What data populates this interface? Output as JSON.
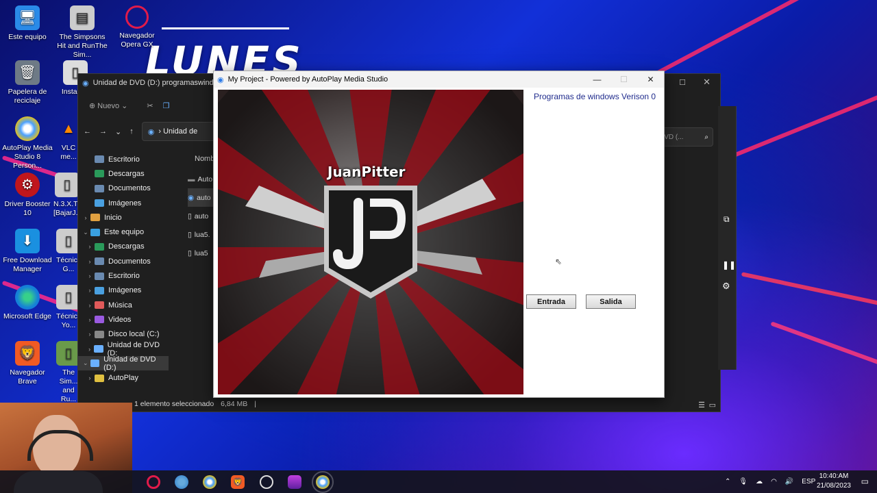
{
  "desktop": {
    "title_text": "LUNES",
    "icons": [
      {
        "label": "Este equipo"
      },
      {
        "label": "The Simpsons Hit and RunThe Sim..."
      },
      {
        "label": "Navegador Opera GX"
      },
      {
        "label": "Papelera de reciclaje"
      },
      {
        "label": "Instagr..."
      },
      {
        "label": "AutoPlay Media Studio 8 Person..."
      },
      {
        "label": "VLC me..."
      },
      {
        "label": "Driver Booster 10"
      },
      {
        "label": "N.3.X.T... [BajarJ..."
      },
      {
        "label": "Free Download Manager"
      },
      {
        "label": "Técnic... G..."
      },
      {
        "label": "Microsoft Edge"
      },
      {
        "label": "Técnic... Yo..."
      },
      {
        "label": "Navegador Brave"
      },
      {
        "label": "The Sim... and Ru..."
      }
    ]
  },
  "explorer": {
    "title": "Unidad de DVD (D:) programaswindows",
    "toolbar_new": "Nuevo",
    "path": "Unidad de",
    "search_placeholder": "DVD (...",
    "column_name": "Nomb",
    "sidebar": [
      {
        "label": "Escritorio",
        "chev": ""
      },
      {
        "label": "Descargas",
        "chev": ""
      },
      {
        "label": "Documentos",
        "chev": ""
      },
      {
        "label": "Imágenes",
        "chev": ""
      },
      {
        "label": "Inicio",
        "chev": "›"
      },
      {
        "label": "Este equipo",
        "chev": "⌄"
      },
      {
        "label": "Descargas",
        "chev": "›"
      },
      {
        "label": "Documentos",
        "chev": "›"
      },
      {
        "label": "Escritorio",
        "chev": "›"
      },
      {
        "label": "Imágenes",
        "chev": "›"
      },
      {
        "label": "Música",
        "chev": "›"
      },
      {
        "label": "Videos",
        "chev": "›"
      },
      {
        "label": "Disco local (C:)",
        "chev": "›"
      },
      {
        "label": "Unidad de DVD (D:",
        "chev": "›"
      },
      {
        "label": "Unidad de DVD (D:)",
        "chev": "⌄"
      },
      {
        "label": "AutoPlay",
        "chev": "›"
      }
    ],
    "files": [
      "Auto",
      "auto",
      "auto",
      "lua5.",
      "lua5"
    ],
    "status_selected": "1 elemento seleccionado",
    "status_size": "6,84 MB"
  },
  "autoplay": {
    "title": "My Project - Powered by AutoPlay Media Studio",
    "label": "Programas de windows Verison 0",
    "logo_text": "JuanPitter",
    "btn_entrada": "Entrada",
    "btn_salida": "Salida"
  },
  "taskbar": {
    "language": "ESP",
    "time": "10:40:AM",
    "date": "21/08/2023"
  },
  "colors": {
    "accent_blue": "#1f2b8c",
    "explorer_bg": "#1f1f1f",
    "taskbar_bg": "#14141c"
  }
}
